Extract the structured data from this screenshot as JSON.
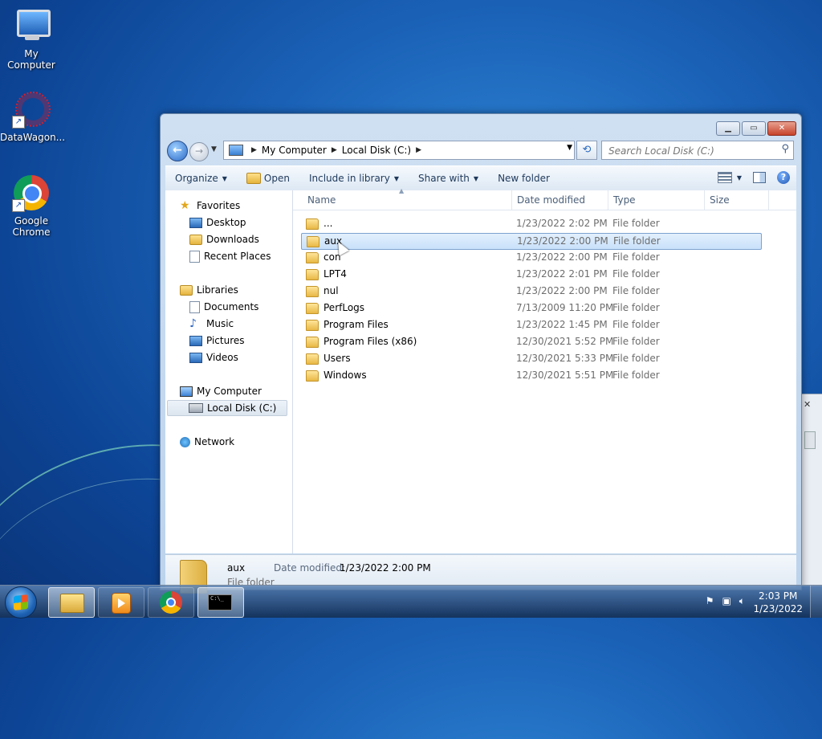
{
  "desktop": {
    "icons": [
      {
        "label": "My Computer"
      },
      {
        "label": "DataWagon..."
      },
      {
        "label": "Google Chrome"
      }
    ]
  },
  "window": {
    "address": {
      "parts": [
        "My Computer",
        "Local Disk (C:)"
      ]
    },
    "search_placeholder": "Search Local Disk (C:)",
    "toolbar": {
      "organize": "Organize",
      "open": "Open",
      "include_in_library": "Include in library",
      "share_with": "Share with",
      "new_folder": "New folder"
    },
    "nav": {
      "favorites": "Favorites",
      "desktop": "Desktop",
      "downloads": "Downloads",
      "recent_places": "Recent Places",
      "libraries": "Libraries",
      "documents": "Documents",
      "music": "Music",
      "pictures": "Pictures",
      "videos": "Videos",
      "my_computer": "My Computer",
      "local_disk": "Local Disk (C:)",
      "network": "Network"
    },
    "columns": {
      "name": "Name",
      "date": "Date modified",
      "type": "Type",
      "size": "Size"
    },
    "files": [
      {
        "name": "...",
        "date": "1/23/2022 2:02 PM",
        "type": "File folder"
      },
      {
        "name": "aux",
        "date": "1/23/2022 2:00 PM",
        "type": "File folder",
        "selected": true
      },
      {
        "name": "con",
        "date": "1/23/2022 2:00 PM",
        "type": "File folder"
      },
      {
        "name": "LPT4",
        "date": "1/23/2022 2:01 PM",
        "type": "File folder"
      },
      {
        "name": "nul",
        "date": "1/23/2022 2:00 PM",
        "type": "File folder"
      },
      {
        "name": "PerfLogs",
        "date": "7/13/2009 11:20 PM",
        "type": "File folder"
      },
      {
        "name": "Program Files",
        "date": "1/23/2022 1:45 PM",
        "type": "File folder"
      },
      {
        "name": "Program Files (x86)",
        "date": "12/30/2021 5:52 PM",
        "type": "File folder"
      },
      {
        "name": "Users",
        "date": "12/30/2021 5:33 PM",
        "type": "File folder"
      },
      {
        "name": "Windows",
        "date": "12/30/2021 5:51 PM",
        "type": "File folder"
      }
    ],
    "details": {
      "name": "aux",
      "type": "File folder",
      "date_label": "Date modified:",
      "date_value": "1/23/2022 2:00 PM"
    }
  },
  "taskbar": {
    "clock_time": "2:03 PM",
    "clock_date": "1/23/2022",
    "cmd_text": "C:\\_"
  }
}
